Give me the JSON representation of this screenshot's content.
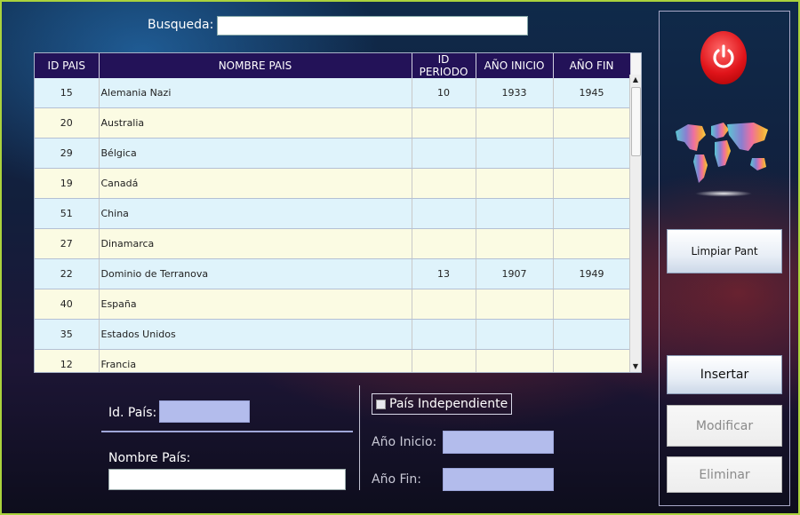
{
  "search": {
    "label": "Busqueda:",
    "value": ""
  },
  "table": {
    "headers": [
      "ID PAIS",
      "NOMBRE PAIS",
      "ID PERIODO",
      "AÑO INICIO",
      "AÑO FIN"
    ],
    "rows": [
      [
        "15",
        "Alemania Nazi",
        "10",
        "1933",
        "1945"
      ],
      [
        "20",
        "Australia",
        "",
        "",
        ""
      ],
      [
        "29",
        "Bélgica",
        "",
        "",
        ""
      ],
      [
        "19",
        "Canadá",
        "",
        "",
        ""
      ],
      [
        "51",
        "China",
        "",
        "",
        ""
      ],
      [
        "27",
        "Dinamarca",
        "",
        "",
        ""
      ],
      [
        "22",
        "Dominio de Terranova",
        "13",
        "1907",
        "1949"
      ],
      [
        "40",
        "España",
        "",
        "",
        ""
      ],
      [
        "35",
        "Estados Unidos",
        "",
        "",
        ""
      ],
      [
        "12",
        "Francia",
        "",
        "",
        ""
      ]
    ]
  },
  "form": {
    "id_pais_label": "Id. País:",
    "id_pais_value": "",
    "nombre_pais_label": "Nombre País:",
    "nombre_pais_value": "",
    "independiente_label": "País Independiente",
    "independiente_checked": false,
    "anio_inicio_label": "Año Inicio:",
    "anio_inicio_value": "",
    "anio_fin_label": "Año Fin:",
    "anio_fin_value": ""
  },
  "actions": {
    "power_icon": "power-icon",
    "map_icon": "world-map-icon",
    "limpiar_label": "Limpiar Pant",
    "insertar_label": "Insertar",
    "modificar_label": "Modificar",
    "eliminar_label": "Eliminar"
  },
  "colors": {
    "header_bg": "#231258",
    "row_odd": "#dff3fb",
    "row_even": "#fbfbe3",
    "frame": "#aad23c",
    "input_fill": "#b3bcec"
  }
}
